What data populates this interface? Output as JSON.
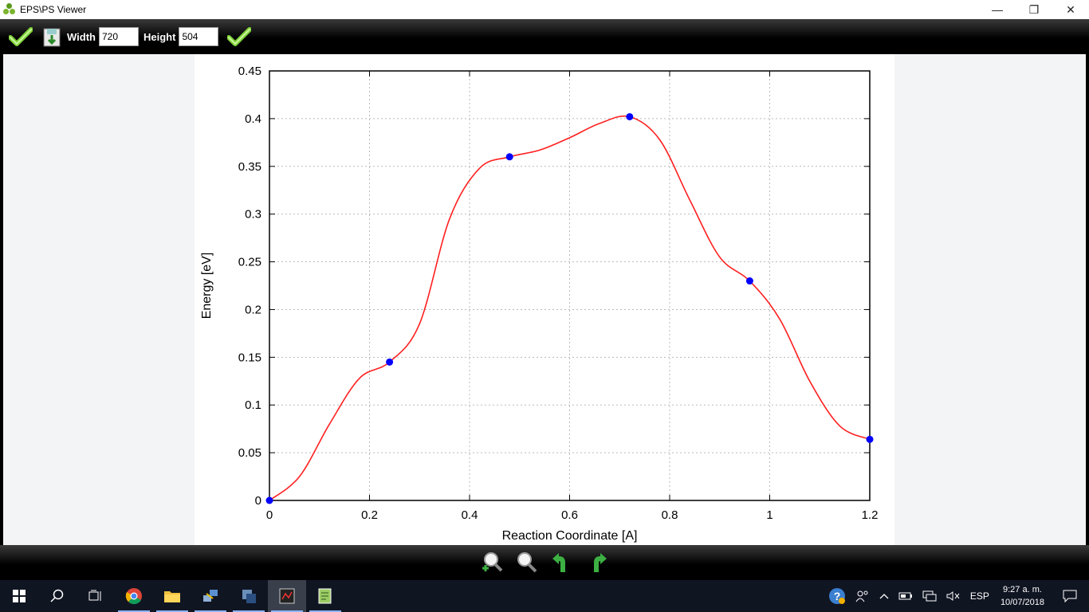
{
  "window": {
    "title": "EPS\\PS Viewer",
    "minimize": "—",
    "restore": "❐",
    "close": "✕"
  },
  "toolbar": {
    "width_label": "Width",
    "width_value": "720",
    "height_label": "Height",
    "height_value": "504"
  },
  "chart_data": {
    "type": "line",
    "xlabel": "Reaction Coordinate [A]",
    "ylabel": "Energy [eV]",
    "xlim": [
      0,
      1.2
    ],
    "ylim": [
      0,
      0.45
    ],
    "xticks": [
      "0",
      "0.2",
      "0.4",
      "0.6",
      "0.8",
      "1",
      "1.2"
    ],
    "yticks": [
      "0",
      "0.05",
      "0.1",
      "0.15",
      "0.2",
      "0.25",
      "0.3",
      "0.35",
      "0.4",
      "0.45"
    ],
    "grid": true,
    "points": {
      "x": [
        0,
        0.24,
        0.48,
        0.72,
        0.96,
        1.2
      ],
      "y": [
        0,
        0.145,
        0.36,
        0.402,
        0.23,
        0.064
      ]
    },
    "curve": {
      "x": [
        0,
        0.06,
        0.12,
        0.18,
        0.24,
        0.3,
        0.36,
        0.42,
        0.48,
        0.54,
        0.6,
        0.66,
        0.72,
        0.78,
        0.84,
        0.9,
        0.96,
        1.02,
        1.08,
        1.14,
        1.2
      ],
      "y": [
        0,
        0.025,
        0.08,
        0.128,
        0.145,
        0.185,
        0.295,
        0.348,
        0.36,
        0.367,
        0.38,
        0.395,
        0.402,
        0.378,
        0.315,
        0.255,
        0.23,
        0.19,
        0.125,
        0.078,
        0.064
      ]
    },
    "colors": {
      "curve": "#ff2020",
      "points": "#0000ff"
    }
  },
  "taskbar": {
    "language": "ESP",
    "time": "9:27 a. m.",
    "date": "10/07/2018"
  }
}
